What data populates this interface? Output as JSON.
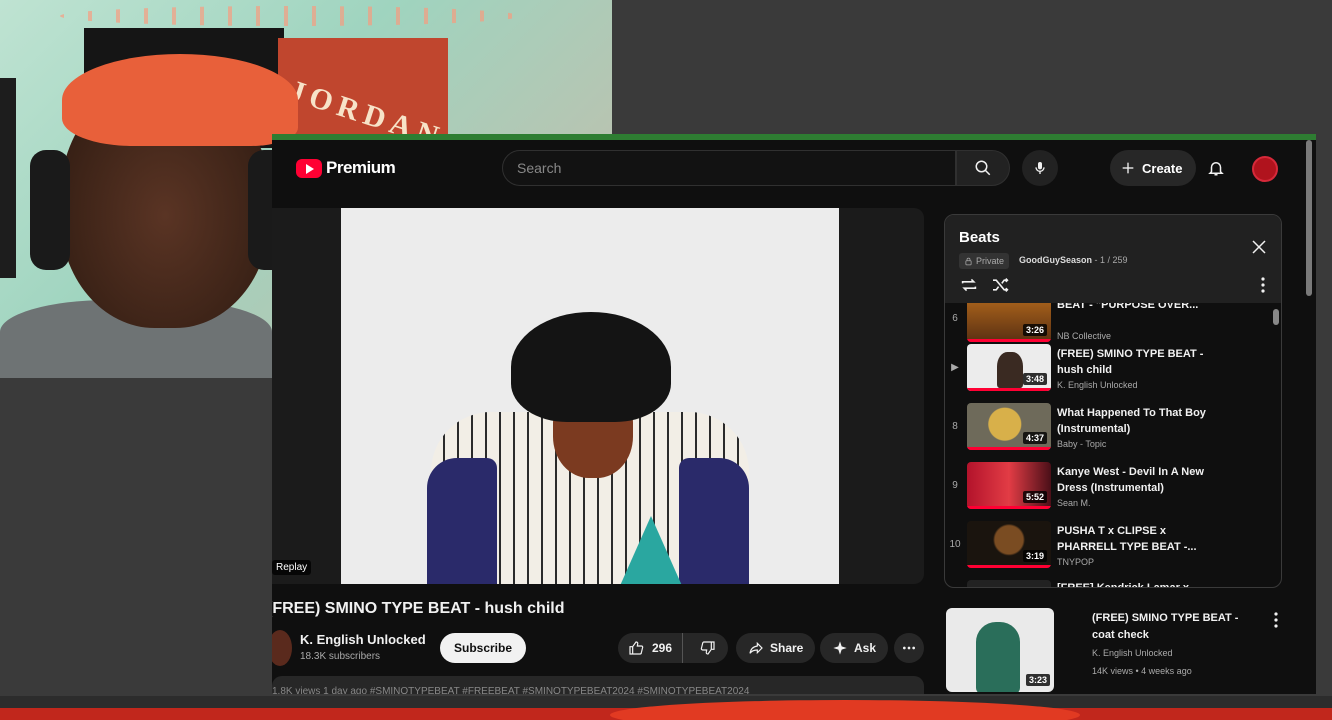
{
  "app": {
    "logo_text": "Premium",
    "search_placeholder": "Search",
    "create_label": "Create"
  },
  "player": {
    "replay_label": "Replay"
  },
  "video": {
    "title": "(FREE) SMINO TYPE BEAT - hush child",
    "channel_name": "K. English Unlocked",
    "subscribers": "18.3K subscribers",
    "subscribe_label": "Subscribe",
    "likes": "296",
    "share_label": "Share",
    "ask_label": "Ask",
    "description_preview": "1.8K views  1 day ago   #SMINOTYPEBEAT #FREEBEAT #SMINOTYPEBEAT2024 #SMINOTYPEBEAT2024"
  },
  "playlist": {
    "title": "Beats",
    "privacy": "Private",
    "owner": "GoodGuySeason",
    "position": "- 1 / 259",
    "items": [
      {
        "index": "6",
        "title": "BEAT - \"PURPOSE OVER...",
        "channel": "NB Collective",
        "duration": "3:26"
      },
      {
        "index": "▶",
        "title": "(FREE) SMINO TYPE BEAT - hush child",
        "channel": "K. English Unlocked",
        "duration": "3:48"
      },
      {
        "index": "8",
        "title": "What Happened To That Boy (Instrumental)",
        "channel": "Baby - Topic",
        "duration": "4:37"
      },
      {
        "index": "9",
        "title": "Kanye West - Devil In A New Dress (Instrumental)",
        "channel": "Sean M.",
        "duration": "5:52"
      },
      {
        "index": "10",
        "title": "PUSHA T x CLIPSE x PHARRELL TYPE BEAT -...",
        "channel": "TNYPOP",
        "duration": "3:19"
      },
      {
        "index": "",
        "title": "[FREE] Kendrick Lamar x Kanye",
        "channel": "",
        "duration": ""
      }
    ]
  },
  "recommended": {
    "title": "(FREE) SMINO TYPE BEAT - coat check",
    "channel": "K. English Unlocked",
    "meta": "14K views • 4 weeks ago",
    "duration": "3:23"
  },
  "webcam": {
    "poster_text": "JORDAN"
  },
  "colors": {
    "accent": "#ff0033",
    "border_top": "#2e7d32",
    "background": "#0f0f0f"
  }
}
